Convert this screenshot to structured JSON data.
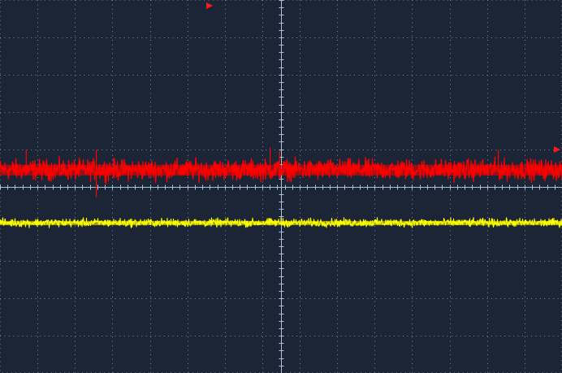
{
  "screen": {
    "background_color": "#1b2536",
    "grid_color": "#8f9aab",
    "axis_color": "#a9c4dd",
    "divisions_x": 15,
    "divisions_y": 10
  },
  "markers": {
    "trigger_position_marker": {
      "icon": "trigger-position-arrow-icon",
      "color": "#ff1a1a"
    },
    "channel2_level_marker": {
      "icon": "channel-level-arrow-icon",
      "color": "#ff1a1a"
    }
  },
  "chart_data": {
    "type": "line",
    "title": "",
    "xlabel": "",
    "ylabel": "",
    "x_divisions": 15,
    "y_divisions": 10,
    "xlim": [
      0,
      15
    ],
    "ylim": [
      0,
      10
    ],
    "grid": true,
    "legend": "none",
    "series": [
      {
        "color": "#ff0000",
        "mean_div": 5.44,
        "noise_band_div": [
          5.05,
          5.85
        ],
        "spikes_div": [
          {
            "x": 0.7,
            "y": 5.98
          },
          {
            "x": 2.57,
            "y": 5.98
          },
          {
            "x": 2.57,
            "y": 4.71
          },
          {
            "x": 7.21,
            "y": 6.05
          },
          {
            "x": 7.46,
            "y": 5.95
          },
          {
            "x": 13.3,
            "y": 5.98
          }
        ]
      },
      {
        "color": "#ffff00",
        "mean_div": 4.02,
        "noise_band_div": [
          3.87,
          4.19
        ],
        "spikes_div": [
          {
            "x": 7.5,
            "y": 4.17
          }
        ]
      }
    ]
  }
}
